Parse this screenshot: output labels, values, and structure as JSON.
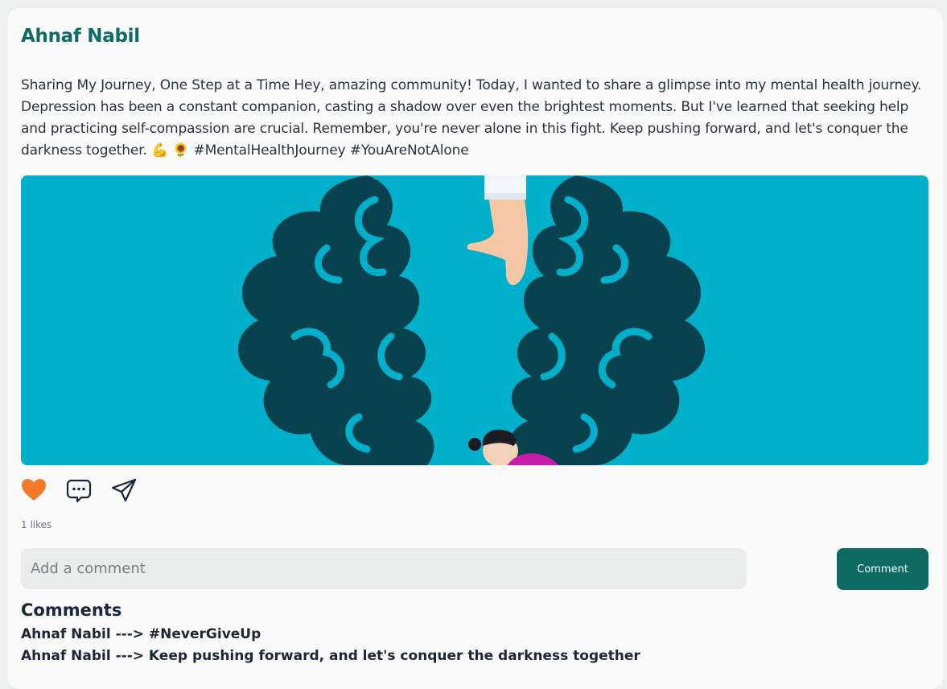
{
  "post": {
    "author": "Ahnaf Nabil",
    "text": "Sharing My Journey, One Step at a Time Hey, amazing community! Today, I wanted to share a glimpse into my mental health journey. Depression has been a constant companion, casting a shadow over even the brightest moments. But I've learned that seeking help and practicing self-compassion are crucial. Remember, you're never alone in this fight. Keep pushing forward, and let's conquer the darkness together. 💪 🌻 #MentalHealthJourney #YouAreNotAlone",
    "image_icon": "brain-illustration-with-helping-hand",
    "likes_label": "1 likes"
  },
  "actions": {
    "like_icon": "heart-icon",
    "comment_icon": "chat-bubble-icon",
    "share_icon": "paper-plane-icon"
  },
  "comment_form": {
    "placeholder": "Add a comment",
    "value": "",
    "button_label": "Comment"
  },
  "comments": {
    "heading": "Comments",
    "items": [
      {
        "text": "Ahnaf Nabil ---> #NeverGiveUp"
      },
      {
        "text": "Ahnaf Nabil ---> Keep pushing forward, and let's conquer the darkness together"
      }
    ]
  },
  "colors": {
    "accent": "#0d6b63",
    "image_background": "#00afc9",
    "brain_dark": "#08424f",
    "heart": "#f47a2a",
    "text": "#1c2638"
  }
}
